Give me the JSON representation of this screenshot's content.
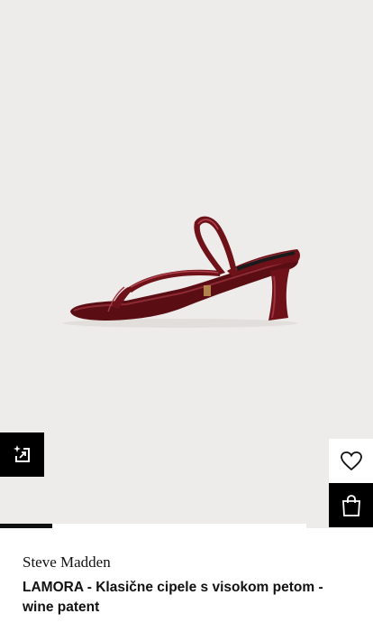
{
  "product": {
    "brand": "Steve Madden",
    "name": "LAMORA - Klasične cipele s visokom petom - wine patent"
  },
  "gallery": {
    "progress_fraction": 0.17
  },
  "colors": {
    "image_background": "#eeecea",
    "shoe": "#6e1119",
    "button_dark": "#000000",
    "button_light": "#ffffff"
  },
  "icons": {
    "try_on": "sparkle-frame-icon",
    "wishlist": "heart-icon",
    "bag": "shopping-bag-icon"
  }
}
